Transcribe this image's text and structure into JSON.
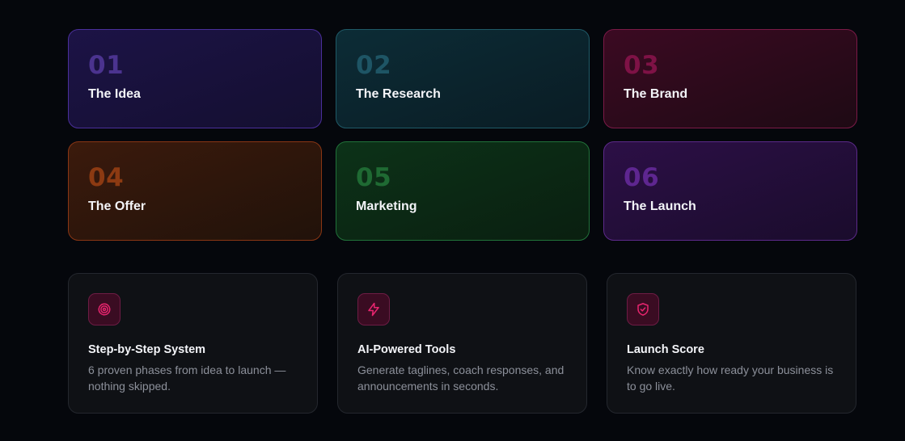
{
  "phases": [
    {
      "number": "01",
      "title": "The Idea"
    },
    {
      "number": "02",
      "title": "The Research"
    },
    {
      "number": "03",
      "title": "The Brand"
    },
    {
      "number": "04",
      "title": "The Offer"
    },
    {
      "number": "05",
      "title": "Marketing"
    },
    {
      "number": "06",
      "title": "The Launch"
    }
  ],
  "features": [
    {
      "icon": "target-icon",
      "title": "Step-by-Step System",
      "description": "6 proven phases from idea to launch — nothing skipped."
    },
    {
      "icon": "lightning-icon",
      "title": "AI-Powered Tools",
      "description": "Generate taglines, coach responses, and announcements in seconds."
    },
    {
      "icon": "shield-check-icon",
      "title": "Launch Score",
      "description": "Know exactly how ready your business is to go live."
    }
  ],
  "colors": {
    "background": "#05070c",
    "accent_pink": "#e8256f",
    "phase_1": "#4b338f",
    "phase_2": "#1e5565",
    "phase_3": "#7e1246",
    "phase_4": "#8c3a12",
    "phase_5": "#1f6a33",
    "phase_6": "#5e2690"
  }
}
